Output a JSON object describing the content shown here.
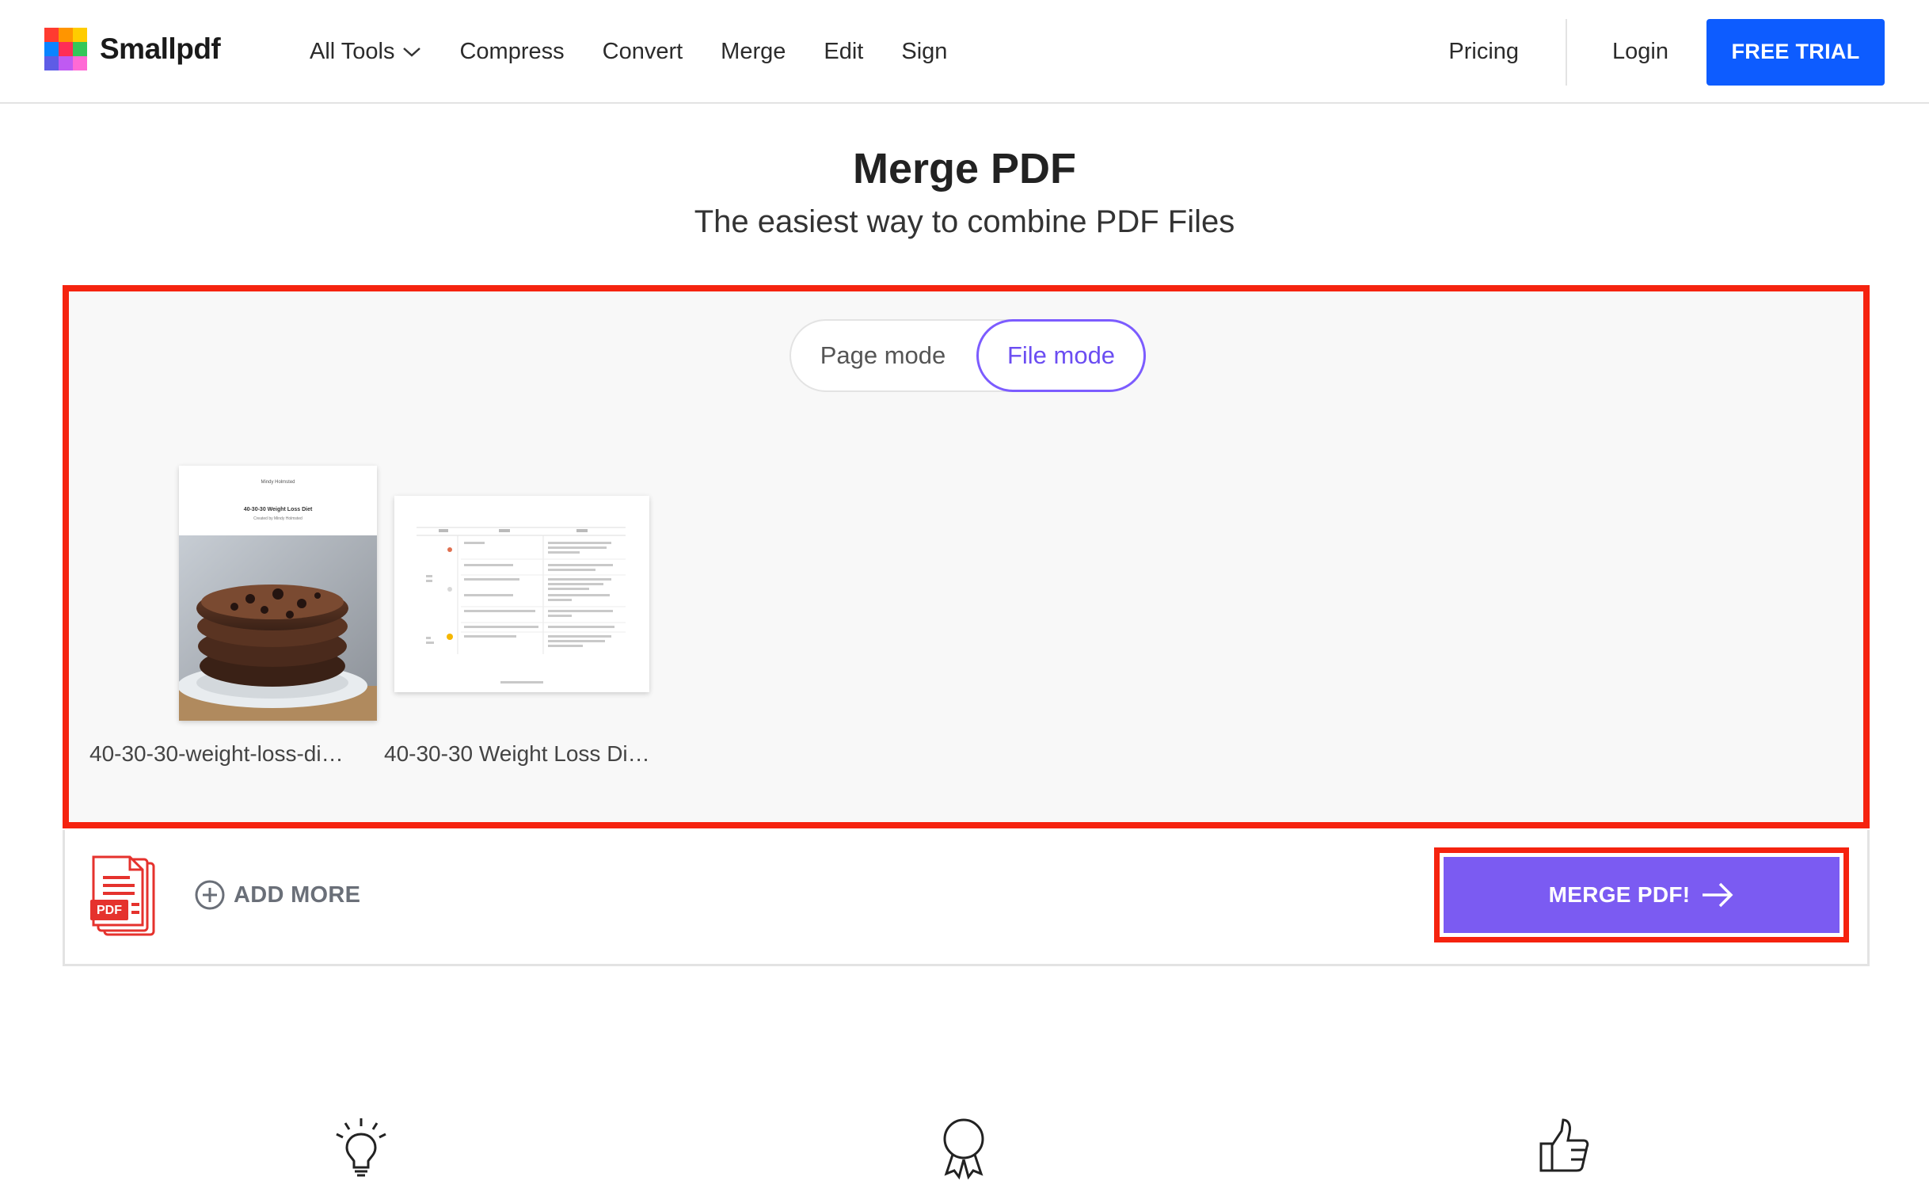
{
  "header": {
    "brand": "Smallpdf",
    "nav": [
      {
        "label": "All Tools",
        "has_dropdown": true
      },
      {
        "label": "Compress"
      },
      {
        "label": "Convert"
      },
      {
        "label": "Merge"
      },
      {
        "label": "Edit"
      },
      {
        "label": "Sign"
      }
    ],
    "pricing_label": "Pricing",
    "login_label": "Login",
    "trial_label": "FREE TRIAL"
  },
  "page": {
    "title": "Merge PDF",
    "subtitle": "The easiest way to combine PDF Files"
  },
  "mode_toggle": {
    "page_mode_label": "Page mode",
    "file_mode_label": "File mode",
    "selected": "File mode"
  },
  "files": [
    {
      "name": "40-30-30-weight-loss-di…",
      "preview": "cookie-photo-document",
      "preview_name": "Mindy Holmsted",
      "preview_heading": "40-30-30 Weight Loss Diet",
      "preview_sub": "Created by Mindy Holmsted"
    },
    {
      "name": "40-30-30 Weight Loss Di…",
      "preview": "meal-table-document"
    }
  ],
  "actions": {
    "file_type_badge": "PDF",
    "add_more_label": "ADD MORE",
    "merge_label": "MERGE PDF!"
  },
  "features": {
    "icons": [
      "lightbulb-icon",
      "award-ribbon-icon",
      "thumbs-up-icon"
    ]
  },
  "colors": {
    "brand_blue": "#0d5cff",
    "merge_purple": "#7b5bf2",
    "highlight_red": "#f5230f",
    "file_mode_purple": "#6b4df2"
  }
}
